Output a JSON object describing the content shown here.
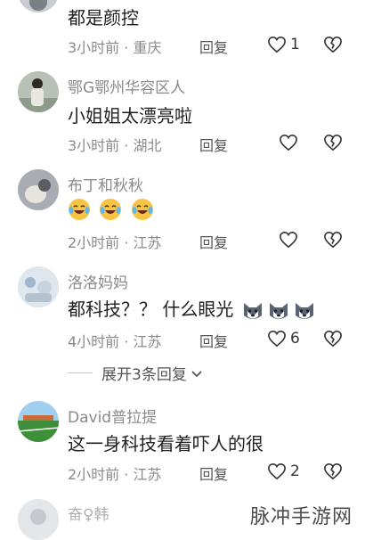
{
  "comments": [
    {
      "name": "",
      "text": "都是颜控",
      "time": "3小时前",
      "location": "重庆",
      "reply_label": "回复",
      "likes": "1"
    },
    {
      "name": "鄂G鄂州华容区人",
      "text": "小姐姐太漂亮啦",
      "time": "3小时前",
      "location": "湖北",
      "reply_label": "回复",
      "likes": ""
    },
    {
      "name": "布丁和秋秋",
      "text": "",
      "emojis": [
        "laugh-cry-icon",
        "laugh-cry-icon",
        "laugh-cry-icon"
      ],
      "time": "2小时前",
      "location": "江苏",
      "reply_label": "回复",
      "likes": ""
    },
    {
      "name": "洛洛妈妈",
      "text": "都科技？？ 什么眼光",
      "emojis": [
        "husky-icon",
        "husky-icon",
        "husky-icon"
      ],
      "time": "4小时前",
      "location": "江苏",
      "reply_label": "回复",
      "likes": "6"
    },
    {
      "name": "David普拉提",
      "text": "这一身科技看着吓人的很",
      "time": "2小时前",
      "location": "江苏",
      "reply_label": "回复",
      "likes": "2"
    },
    {
      "name": "奋♀韩",
      "text": "",
      "time": "",
      "location": "",
      "reply_label": "",
      "likes": ""
    }
  ],
  "expand_replies": {
    "label": "展开3条回复"
  },
  "meta_separator": "·",
  "watermark": "脉冲手游网",
  "colors": {
    "meta": "#8a8a8a",
    "text": "#1f1f1f",
    "emoji_face": "#f6c343"
  }
}
